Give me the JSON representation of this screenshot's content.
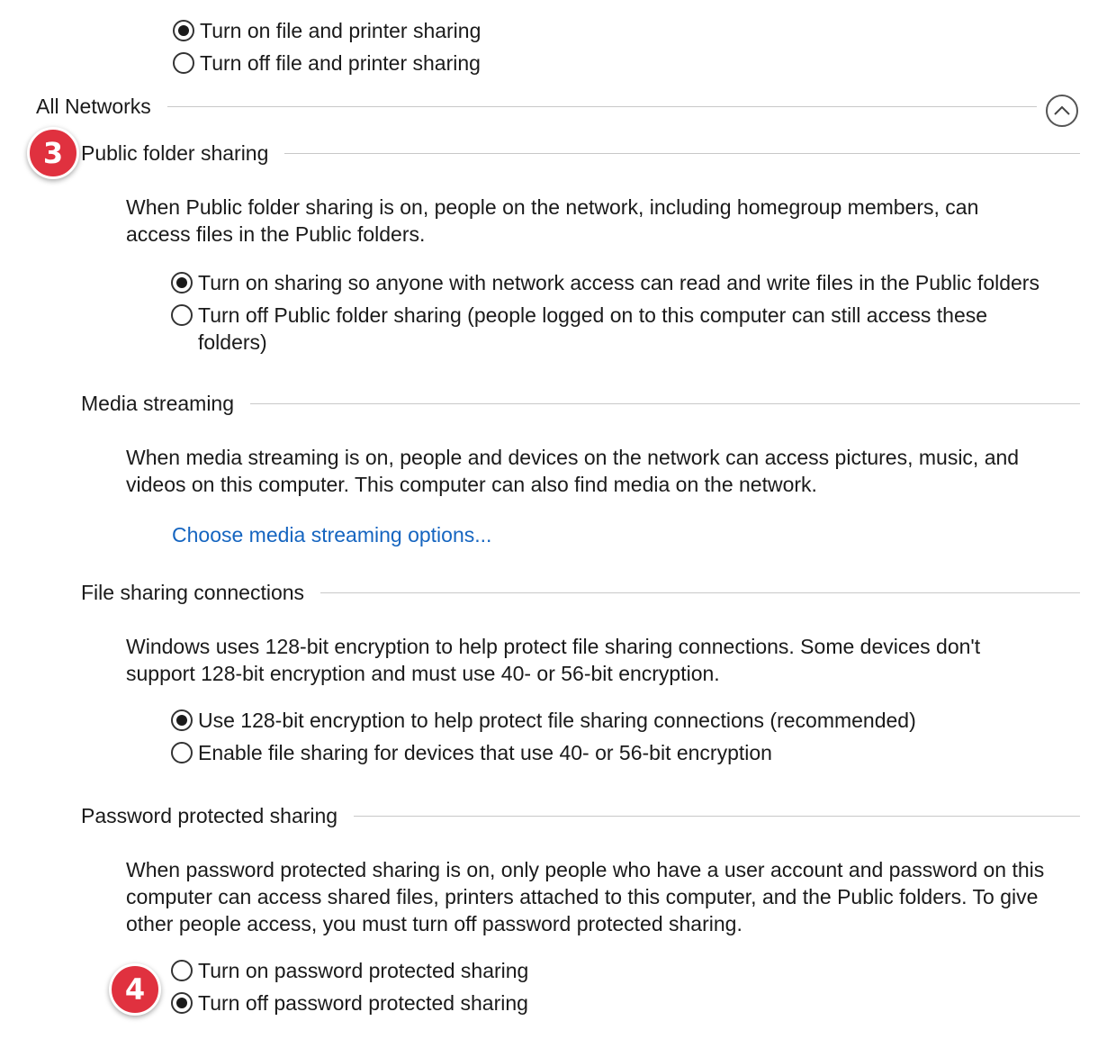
{
  "top_radios": [
    {
      "label": "Turn on file and printer sharing",
      "selected": true
    },
    {
      "label": "Turn off file and printer sharing",
      "selected": false
    }
  ],
  "all_networks": {
    "title": "All Networks",
    "collapse_icon": "chevron-up-icon"
  },
  "badges": {
    "step3": "3",
    "step4": "4",
    "color": "#e0313f"
  },
  "public_folder": {
    "title": "Public folder sharing",
    "description_line1": "When Public folder sharing is on, people on the network, including homegroup members, can",
    "description_line2": "access files in the Public folders.",
    "options": [
      {
        "label": "Turn on sharing so anyone with network access can read and write files in the Public folders",
        "selected": true
      },
      {
        "label": "Turn off Public folder sharing (people logged on to this computer can still access these",
        "label_cont": "folders)",
        "selected": false
      }
    ]
  },
  "media_streaming": {
    "title": "Media streaming",
    "description_line1": "When media streaming is on, people and devices on the network can access pictures, music, and",
    "description_line2": "videos on this computer. This computer can also find media on the network.",
    "link": "Choose media streaming options...",
    "link_color": "#1565c0"
  },
  "file_sharing": {
    "title": "File sharing connections",
    "description_line1": "Windows uses 128-bit encryption to help protect file sharing connections. Some devices don't",
    "description_line2": "support 128-bit encryption and must use 40- or 56-bit encryption.",
    "options": [
      {
        "label": "Use 128-bit encryption to help protect file sharing connections (recommended)",
        "selected": true
      },
      {
        "label": "Enable file sharing for devices that use 40- or 56-bit encryption",
        "selected": false
      }
    ]
  },
  "password_sharing": {
    "title": "Password protected sharing",
    "description_line1": "When password protected sharing is on, only people who have a user account and password on this",
    "description_line2": "computer can access shared files, printers attached to this computer, and the Public folders. To give",
    "description_line3": "other people access, you must turn off password protected sharing.",
    "options": [
      {
        "label": "Turn on password protected sharing",
        "selected": false
      },
      {
        "label": "Turn off password protected sharing",
        "selected": true
      }
    ]
  }
}
